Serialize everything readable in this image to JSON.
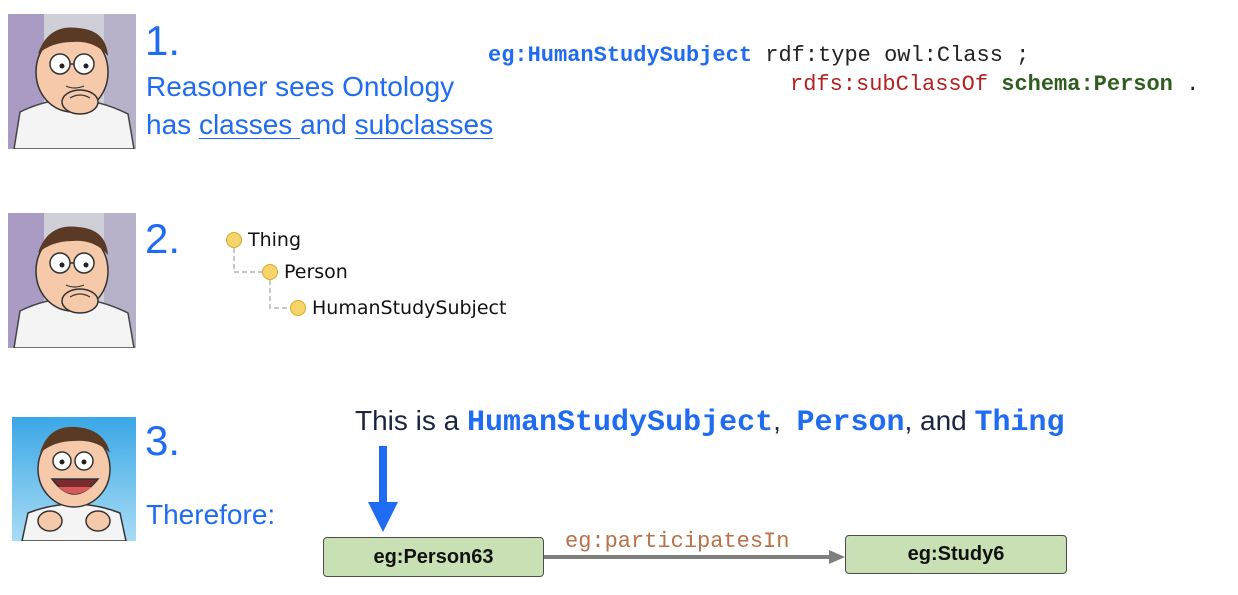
{
  "steps": [
    {
      "number": "1.",
      "avatar": "peter-thinking-image",
      "caption": {
        "line1": "Reasoner sees Ontology",
        "line2_prefix": "has ",
        "line2_link1": "classes ",
        "line2_mid": "and ",
        "line2_link2": "subclasses"
      }
    },
    {
      "number": "2.",
      "avatar": "peter-thinking-image"
    },
    {
      "number": "3.",
      "avatar": "peter-excited-image",
      "caption": "Therefore:"
    }
  ],
  "code": {
    "line1": {
      "subject": "eg:HumanStudySubject",
      "predicate": "rdf:type",
      "object": "owl:Class",
      "end": ";"
    },
    "line2": {
      "predicate": "rdfs:subClassOf",
      "object": "schema:Person",
      "end": "."
    }
  },
  "tree": [
    {
      "label": "Thing",
      "level": 0
    },
    {
      "label": "Person",
      "level": 1
    },
    {
      "label": "HumanStudySubject",
      "level": 2
    }
  ],
  "statement": {
    "prefix": "This is a ",
    "class1": "HumanStudySubject",
    "sep1": ",  ",
    "class2": "Person",
    "sep2": ", and ",
    "class3": "Thing"
  },
  "graph": {
    "source": "eg:Person63",
    "edge": "eg:participatesIn",
    "target": "eg:Study6"
  },
  "colors": {
    "accent_blue": "#1f6bf2",
    "node_fill": "#c8e0b4",
    "tree_dot": "#f7d469",
    "edge_label": "#b8714a",
    "code_red": "#b22222",
    "code_green": "#2e5d1f"
  }
}
